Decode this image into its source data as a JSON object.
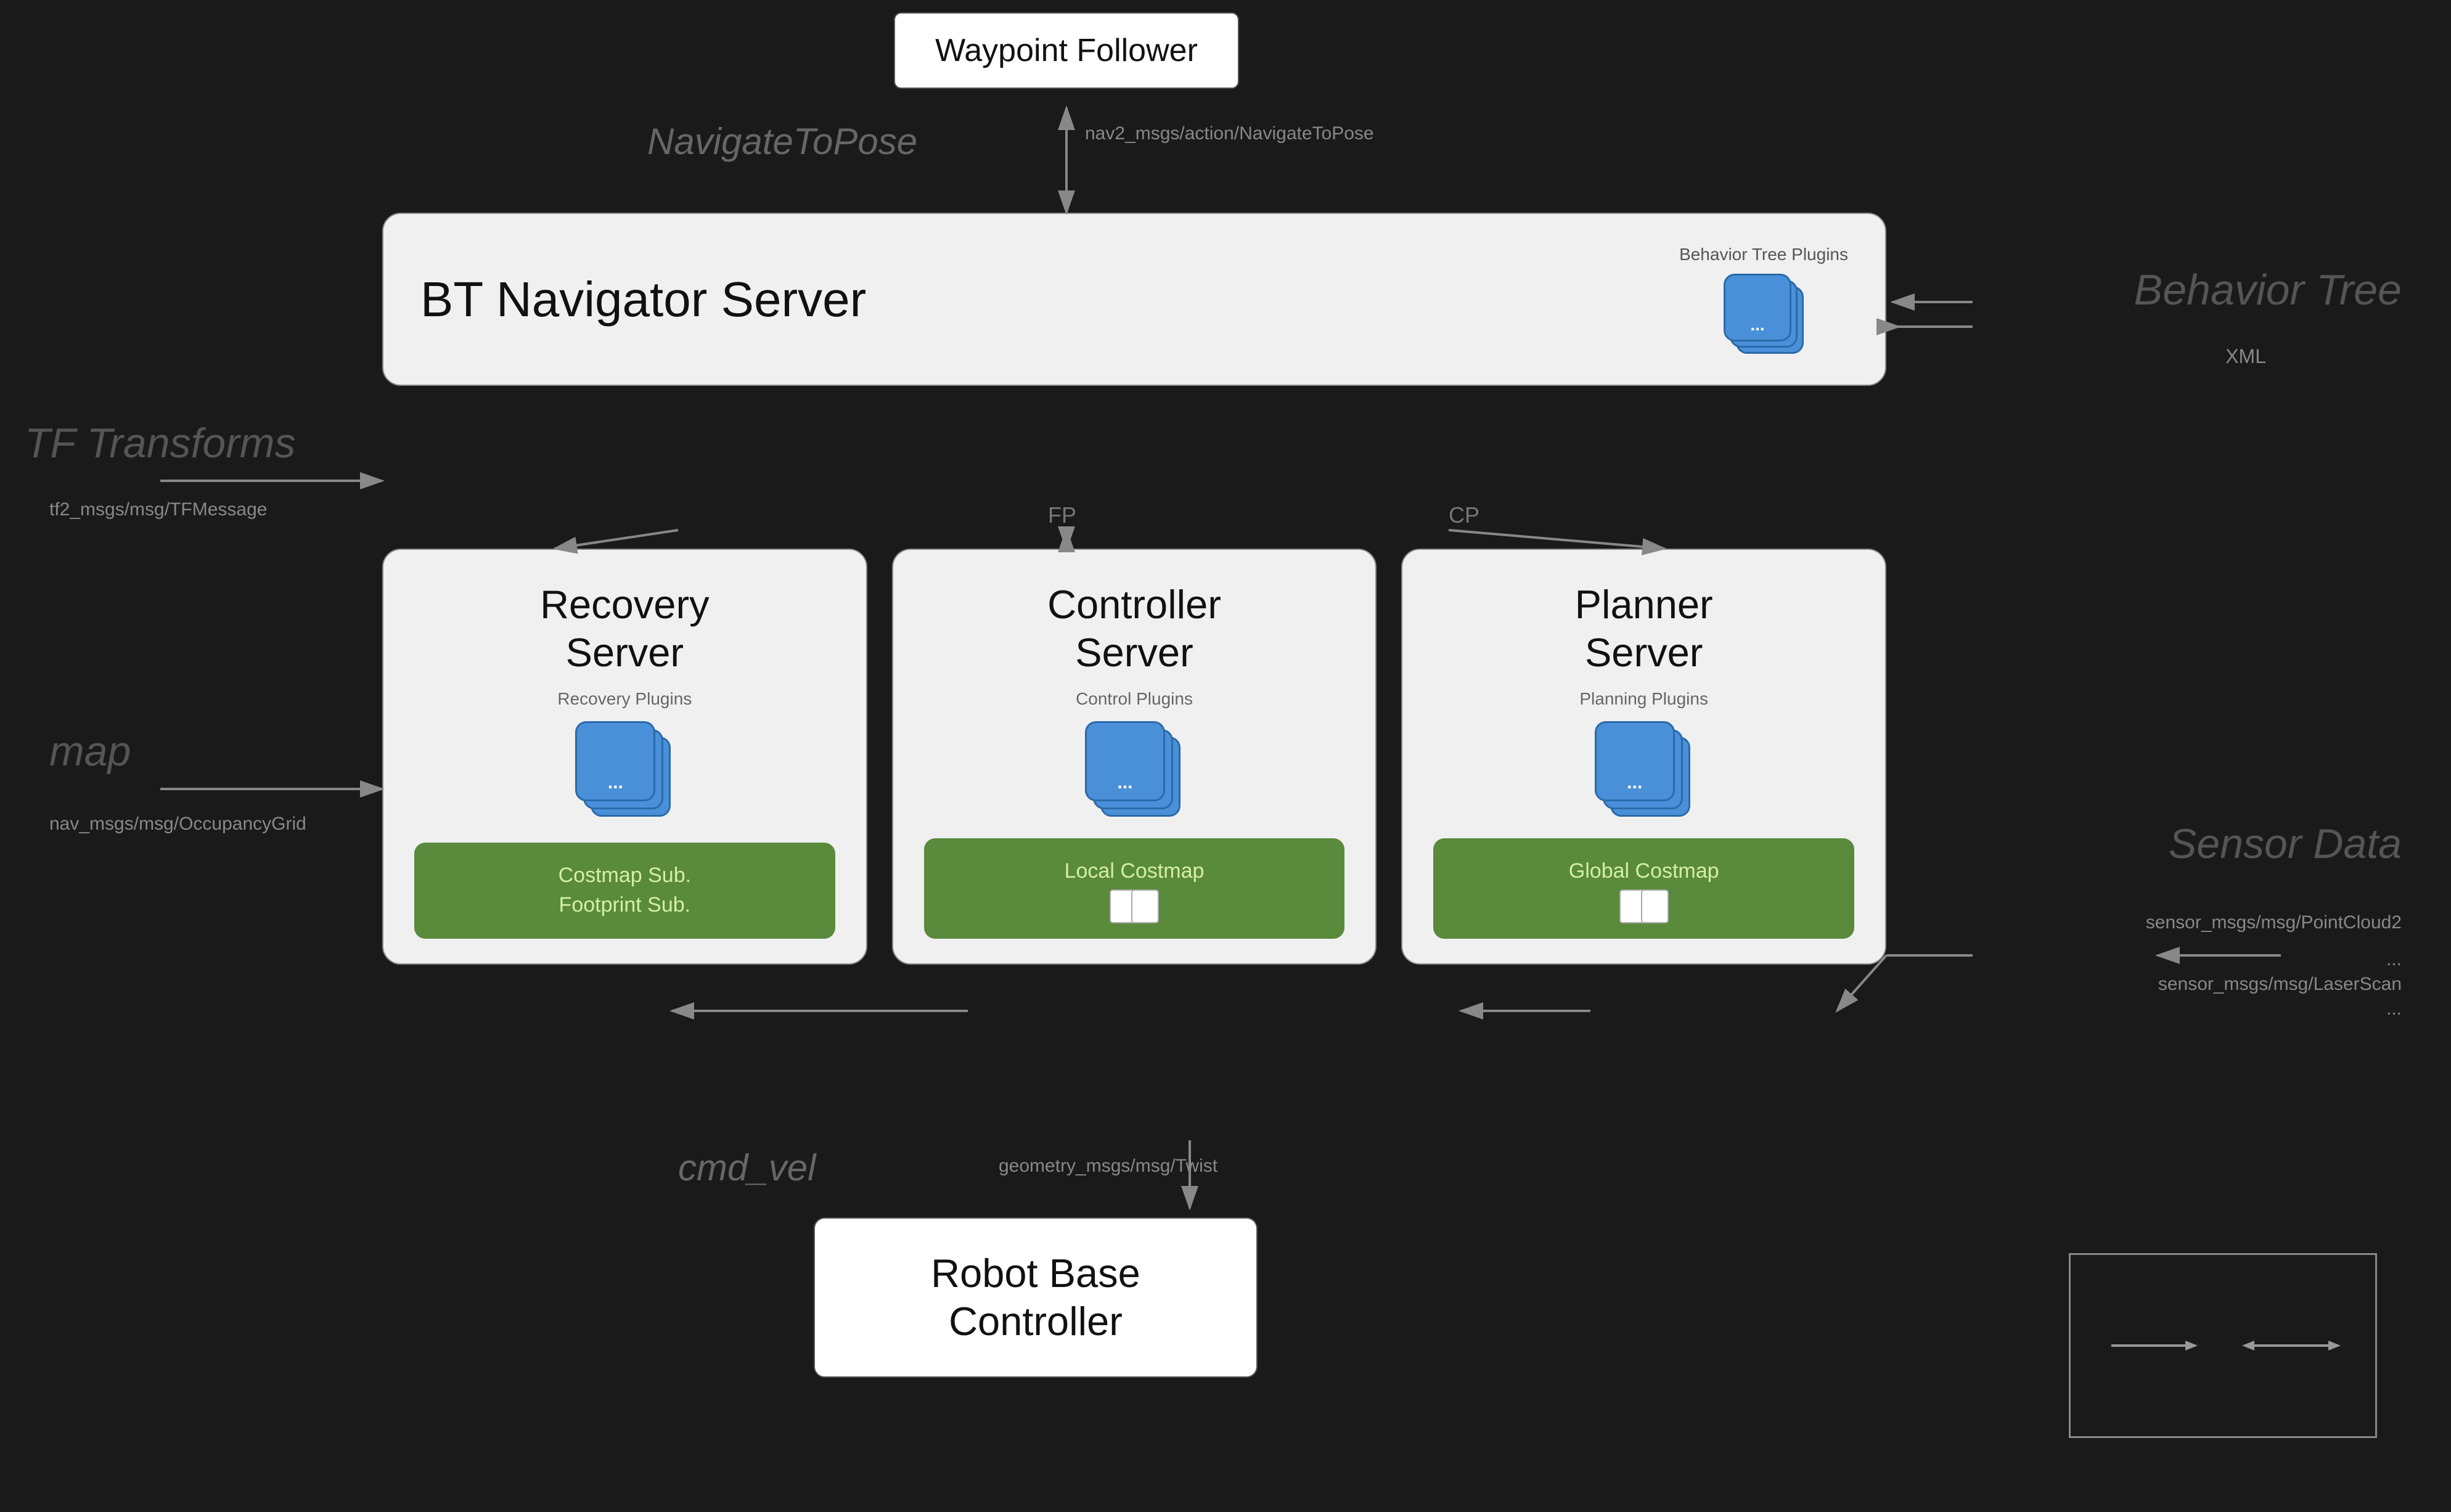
{
  "waypoint": {
    "title": "Waypoint Follower"
  },
  "navigate": {
    "label": "NavigateToPose",
    "message": "nav2_msgs/action/NavigateToPose"
  },
  "bt_navigator": {
    "title": "BT Navigator Server",
    "plugin_label": "Behavior Tree Plugins"
  },
  "behavior_tree": {
    "label": "Behavior Tree",
    "xml": "XML"
  },
  "tf_transforms": {
    "label": "TF Transforms",
    "message": "tf2_msgs/msg/TFMessage"
  },
  "map": {
    "label": "map",
    "message": "nav_msgs/msg/OccupancyGrid"
  },
  "recovery_server": {
    "title": "Recovery Server",
    "plugin_label": "Recovery Plugins",
    "costmap_label": "Costmap Sub.\nFootprint Sub."
  },
  "controller_server": {
    "title": "Controller Server",
    "plugin_label": "Control Plugins",
    "costmap_label": "Local Costmap"
  },
  "planner_server": {
    "title": "Planner Server",
    "plugin_label": "Planning Plugins",
    "costmap_label": "Global Costmap"
  },
  "fp_label": "FP",
  "cp_label": "CP",
  "sensor_data": {
    "label": "Sensor Data",
    "messages": [
      "sensor_msgs/msg/PointCloud2",
      "...",
      "sensor_msgs/msg/LaserScan",
      "..."
    ]
  },
  "cmdvel": {
    "label": "cmd_vel",
    "message": "geometry_msgs/msg/Twist"
  },
  "robot_base": {
    "title": "Robot Base\nController"
  },
  "legend": {
    "arrow1": "→",
    "arrow2": "←→"
  }
}
